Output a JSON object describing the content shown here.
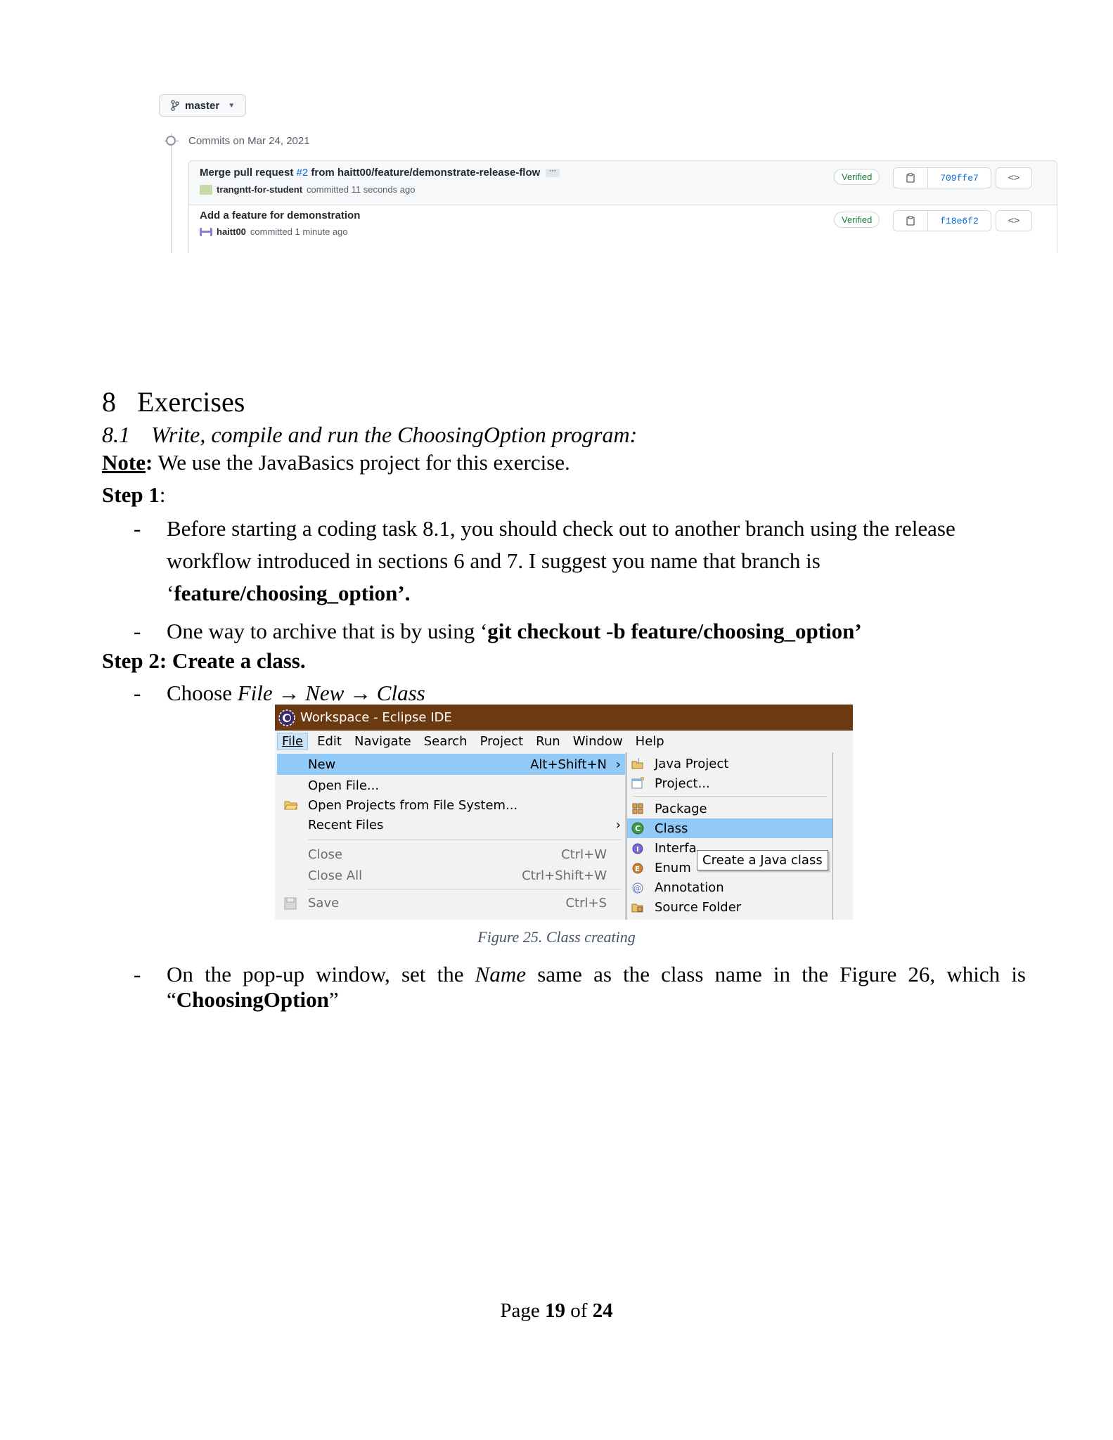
{
  "github": {
    "branch_label": "master",
    "commits_date": "Commits on Mar 24, 2021",
    "commits": [
      {
        "title_prefix": "Merge pull request ",
        "pr_link": "#2",
        "title_suffix": " from haitt00/feature/demonstrate-release-flow",
        "author": "trangntt-for-student",
        "time": "committed 11 seconds ago",
        "verified": "Verified",
        "sha": "709ffe7",
        "avatar_color": "#c7d9a8"
      },
      {
        "title": "Add a feature for demonstration",
        "author": "haitt00",
        "time": "committed 1 minute ago",
        "verified": "Verified",
        "sha": "f18e6f2",
        "avatar_color": "#8a7fd8"
      }
    ]
  },
  "section": {
    "number": "8",
    "title": "Exercises"
  },
  "subsection": {
    "number": "8.1",
    "title": "Write, compile and run the ChoosingOption program:"
  },
  "note": {
    "label": "Note",
    "colon": ":",
    "text": " We use the JavaBasics project for this exercise."
  },
  "step1": {
    "label": "Step 1",
    "colon": ":",
    "bullet1_line1": "Before starting a coding task 8.1, you should check out to another branch using the release",
    "bullet1_line2": "workflow introduced in sections 6 and 7. I suggest you name that branch is",
    "bullet1_line3_open": "‘",
    "bullet1_line3_bold": "feature/choosing_option’.",
    "bullet2_text": "One way to archive that is by using ‘",
    "bullet2_bold": "git checkout -b feature/choosing_option’"
  },
  "step2": {
    "label": "Step 2: Create a class.",
    "bullet1_prefix": "Choose ",
    "bullet1_italic": "File → New → Class",
    "bullet2_p1": "On the pop-up window, set the ",
    "bullet2_italic": "Name",
    "bullet2_p2": " same as the class name in the Figure 26, which is",
    "bullet2_open": "“",
    "bullet2_bold": "ChoosingOption",
    "bullet2_close": "”"
  },
  "bullet_char": "-",
  "eclipse": {
    "window_title": "Workspace - Eclipse IDE",
    "menus": [
      "File",
      "Edit",
      "Navigate",
      "Search",
      "Project",
      "Run",
      "Window",
      "Help"
    ],
    "file_menu": {
      "new": "New",
      "new_accel": "Alt+Shift+N",
      "open_file": "Open File...",
      "open_projects": "Open Projects from File System...",
      "recent_files": "Recent Files",
      "close": "Close",
      "close_accel": "Ctrl+W",
      "close_all": "Close All",
      "close_all_accel": "Ctrl+Shift+W",
      "save": "Save",
      "save_accel": "Ctrl+S"
    },
    "new_submenu": {
      "java_project": "Java Project",
      "project": "Project...",
      "package": "Package",
      "class": "Class",
      "interface": "Interfa",
      "enum": "Enum",
      "annotation": "Annotation",
      "source_folder": "Source Folder"
    },
    "tooltip": "Create a Java class",
    "colors": {
      "titlebar": "#6b3a10",
      "highlight": "#91c9f7"
    }
  },
  "caption": "Figure 25. Class creating",
  "footer": {
    "page_word": "Page ",
    "current": "19",
    "of_word": " of ",
    "total": "24"
  }
}
